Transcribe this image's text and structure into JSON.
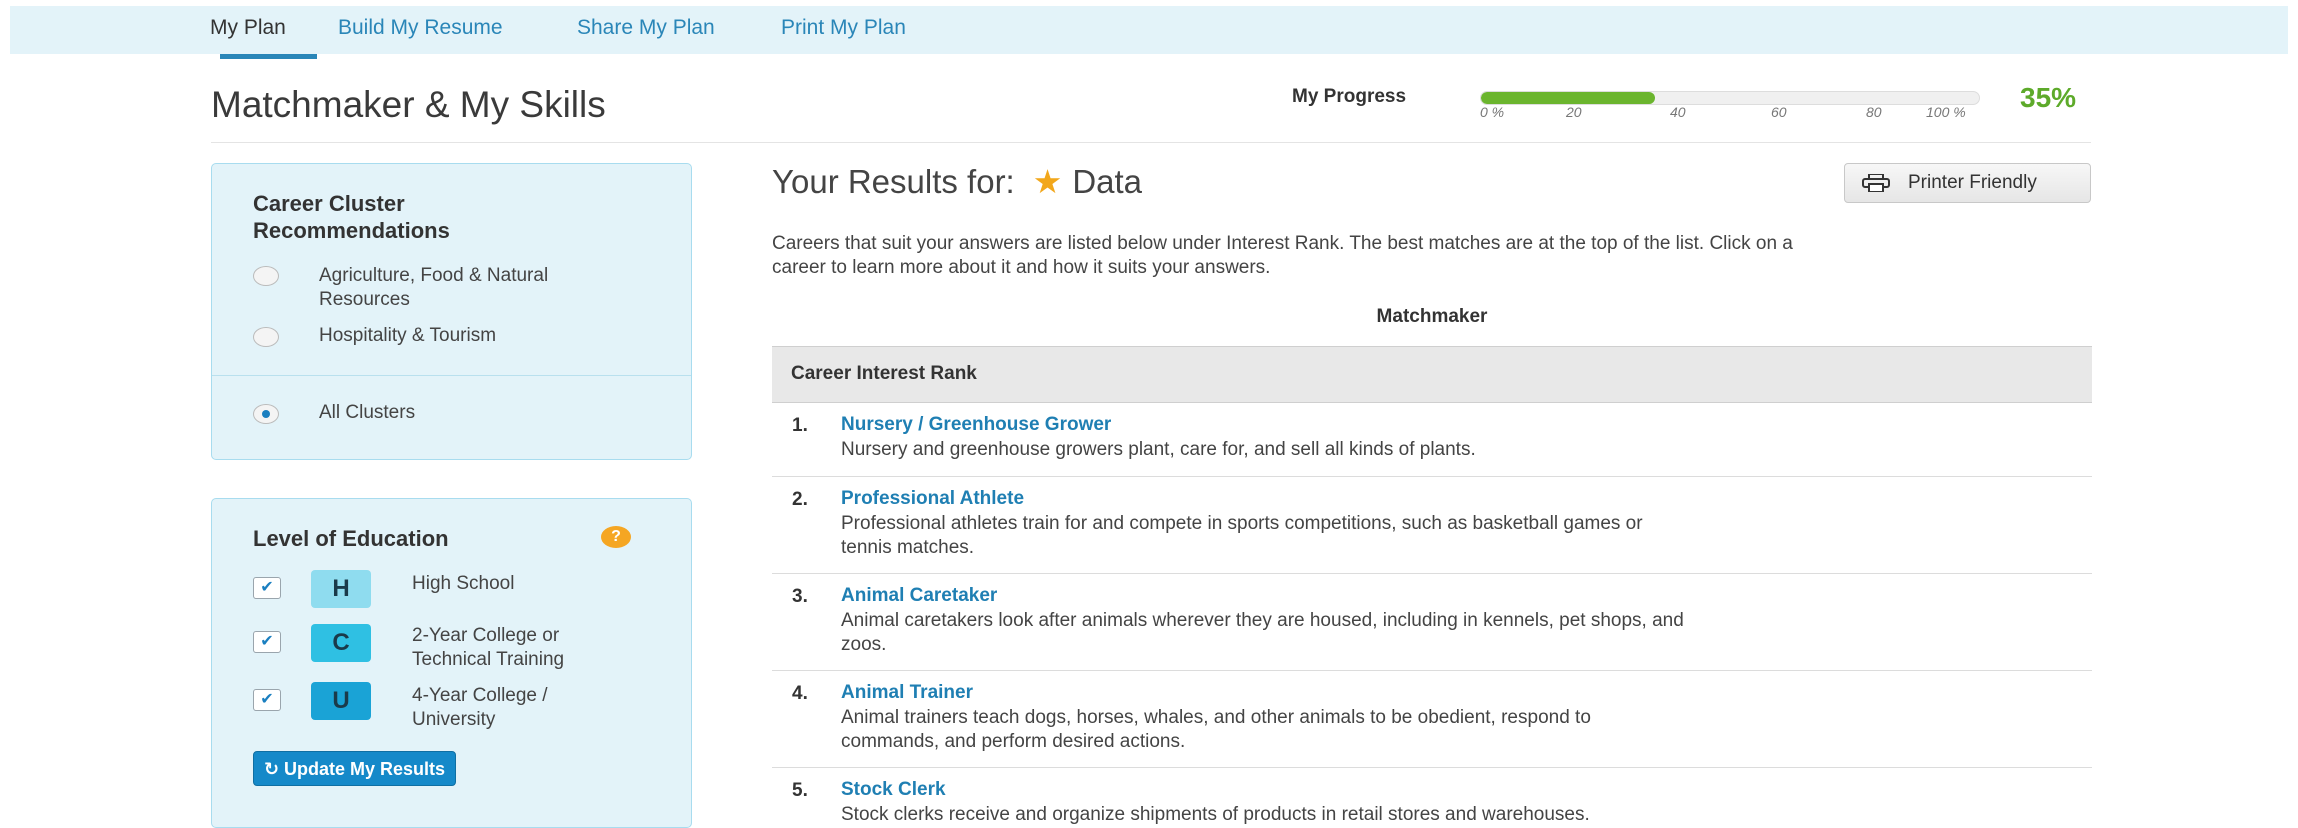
{
  "tabs": [
    {
      "label": "My Plan",
      "active": true
    },
    {
      "label": "Build My Resume"
    },
    {
      "label": "Share My Plan"
    },
    {
      "label": "Print My Plan"
    }
  ],
  "page_title": "Matchmaker & My Skills",
  "progress": {
    "label": "My Progress",
    "value_percent": 35,
    "display": "35%",
    "ticks": [
      "0 %",
      "20",
      "40",
      "60",
      "80",
      "100 %"
    ]
  },
  "cluster_panel": {
    "title_line1": "Career Cluster",
    "title_line2": "Recommendations",
    "options": [
      {
        "line1": "Agriculture, Food & Natural",
        "line2": "Resources",
        "selected": false
      },
      {
        "line1": "Hospitality & Tourism",
        "line2": "",
        "selected": false
      },
      {
        "line1": "All Clusters",
        "line2": "",
        "selected": true
      }
    ]
  },
  "education_panel": {
    "title": "Level of Education",
    "help": "?",
    "levels": [
      {
        "badge": "H",
        "line1": "High School",
        "line2": "",
        "checked": true,
        "color": "#8fdcef"
      },
      {
        "badge": "C",
        "line1": "2-Year College or",
        "line2": "Technical Training",
        "checked": true,
        "color": "#2fc0e3"
      },
      {
        "badge": "U",
        "line1": "4-Year College /",
        "line2": "University",
        "checked": true,
        "color": "#1aa3d6"
      }
    ],
    "update_button": "↻ Update My Results"
  },
  "results": {
    "heading_prefix": "Your Results for:",
    "star": "★",
    "heading_term": "Data",
    "printer_button": "Printer Friendly",
    "intro_line1": "Careers that suit your answers are listed below under Interest Rank. The best matches are at the top of the list. Click on a",
    "intro_line2": "career to learn more about it and how it suits your answers.",
    "section_label": "Matchmaker",
    "table_header": "Career Interest Rank",
    "careers": [
      {
        "num": "1.",
        "title": "Nursery / Greenhouse Grower",
        "desc1": "Nursery and greenhouse growers plant, care for, and sell all kinds of plants.",
        "desc2": ""
      },
      {
        "num": "2.",
        "title": "Professional Athlete",
        "desc1": "Professional athletes train for and compete in sports competitions, such as basketball games or",
        "desc2": "tennis matches."
      },
      {
        "num": "3.",
        "title": "Animal Caretaker",
        "desc1": "Animal caretakers look after animals wherever they are housed, including in kennels, pet shops, and",
        "desc2": "zoos."
      },
      {
        "num": "4.",
        "title": "Animal Trainer",
        "desc1": "Animal trainers teach dogs, horses, whales, and other animals to be obedient, respond to",
        "desc2": "commands, and perform desired actions."
      },
      {
        "num": "5.",
        "title": "Stock Clerk",
        "desc1": "Stock clerks receive and organize shipments of products in retail stores and warehouses.",
        "desc2": ""
      }
    ]
  }
}
